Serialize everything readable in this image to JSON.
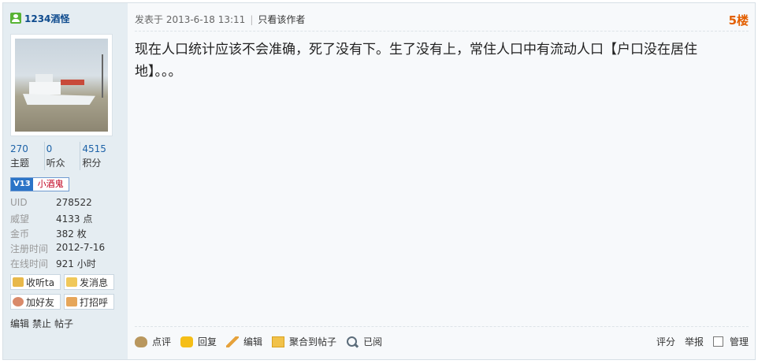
{
  "user": {
    "name": "1234酒怪",
    "stats": [
      {
        "num": "270",
        "label": "主题"
      },
      {
        "num": "0",
        "label": "听众"
      },
      {
        "num": "4515",
        "label": "积分"
      }
    ],
    "badge": {
      "level": "V13",
      "title": "小酒鬼"
    },
    "info": [
      {
        "k": "UID",
        "v": "278522"
      },
      {
        "k": "威望",
        "v": "4133 点"
      },
      {
        "k": "金币",
        "v": "382 枚"
      },
      {
        "k": "注册时间",
        "v": "2012-7-16"
      },
      {
        "k": "在线时间",
        "v": "921 小时"
      }
    ],
    "actions": {
      "follow": "收听ta",
      "message": "发消息",
      "add_friend": "加好友",
      "greet": "打招呼"
    },
    "mini_links": {
      "edit": "编辑",
      "ban": "禁止",
      "posts": "帖子"
    }
  },
  "post": {
    "posted_at": "发表于 2013-6-18 13:11",
    "author_only": "只看该作者",
    "floor": "5楼",
    "message": "现在人口统计应该不会准确，死了没有下。生了没有上，常住人口中有流动人口【户口没在居住地】。。。"
  },
  "toolbar": {
    "rate": "点评",
    "reply": "回复",
    "edit": "编辑",
    "merge": "聚合到帖子",
    "read": "已阅",
    "score": "评分",
    "report": "举报",
    "manage": "管理"
  },
  "colors": {
    "accent": "#e35f00",
    "link": "#1e63a8",
    "username": "#0e4b8e",
    "sidebar": "#e5edf2"
  }
}
